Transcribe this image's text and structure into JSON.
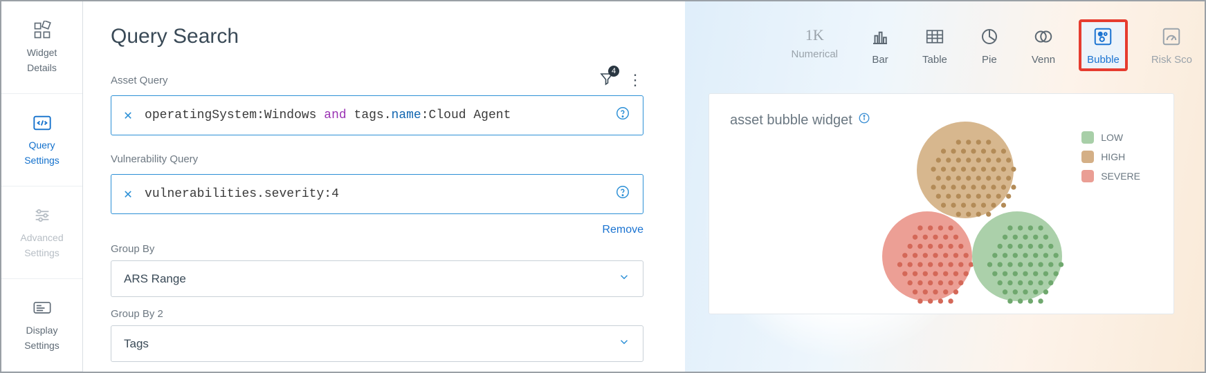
{
  "sidebar": {
    "items": [
      {
        "line1": "Widget",
        "line2": "Details",
        "state": "normal"
      },
      {
        "line1": "Query",
        "line2": "Settings",
        "state": "active"
      },
      {
        "line1": "Advanced",
        "line2": "Settings",
        "state": "disabled"
      },
      {
        "line1": "Display",
        "line2": "Settings",
        "state": "normal"
      }
    ]
  },
  "page": {
    "title": "Query Search"
  },
  "assetQuery": {
    "label": "Asset Query",
    "filterCount": "4",
    "tokens": {
      "t1": "operatingSystem:Windows ",
      "kw_and": "and ",
      "t2": "tags.",
      "kw_name": "name",
      "t3": ":Cloud Agent"
    }
  },
  "vulnQuery": {
    "label": "Vulnerability Query",
    "text": "vulnerabilities.severity:4",
    "removeLabel": "Remove"
  },
  "groupBy": {
    "label": "Group By",
    "value": "ARS Range"
  },
  "groupBy2": {
    "label": "Group By 2",
    "value": "Tags"
  },
  "chartTabs": [
    {
      "key": "numerical",
      "label": "Numerical"
    },
    {
      "key": "bar",
      "label": "Bar"
    },
    {
      "key": "table",
      "label": "Table"
    },
    {
      "key": "pie",
      "label": "Pie"
    },
    {
      "key": "venn",
      "label": "Venn"
    },
    {
      "key": "bubble",
      "label": "Bubble"
    },
    {
      "key": "riskscore",
      "label": "Risk Sco"
    }
  ],
  "widget": {
    "title": "asset bubble widget",
    "legend": {
      "low": "LOW",
      "high": "HIGH",
      "severe": "SEVERE"
    }
  }
}
